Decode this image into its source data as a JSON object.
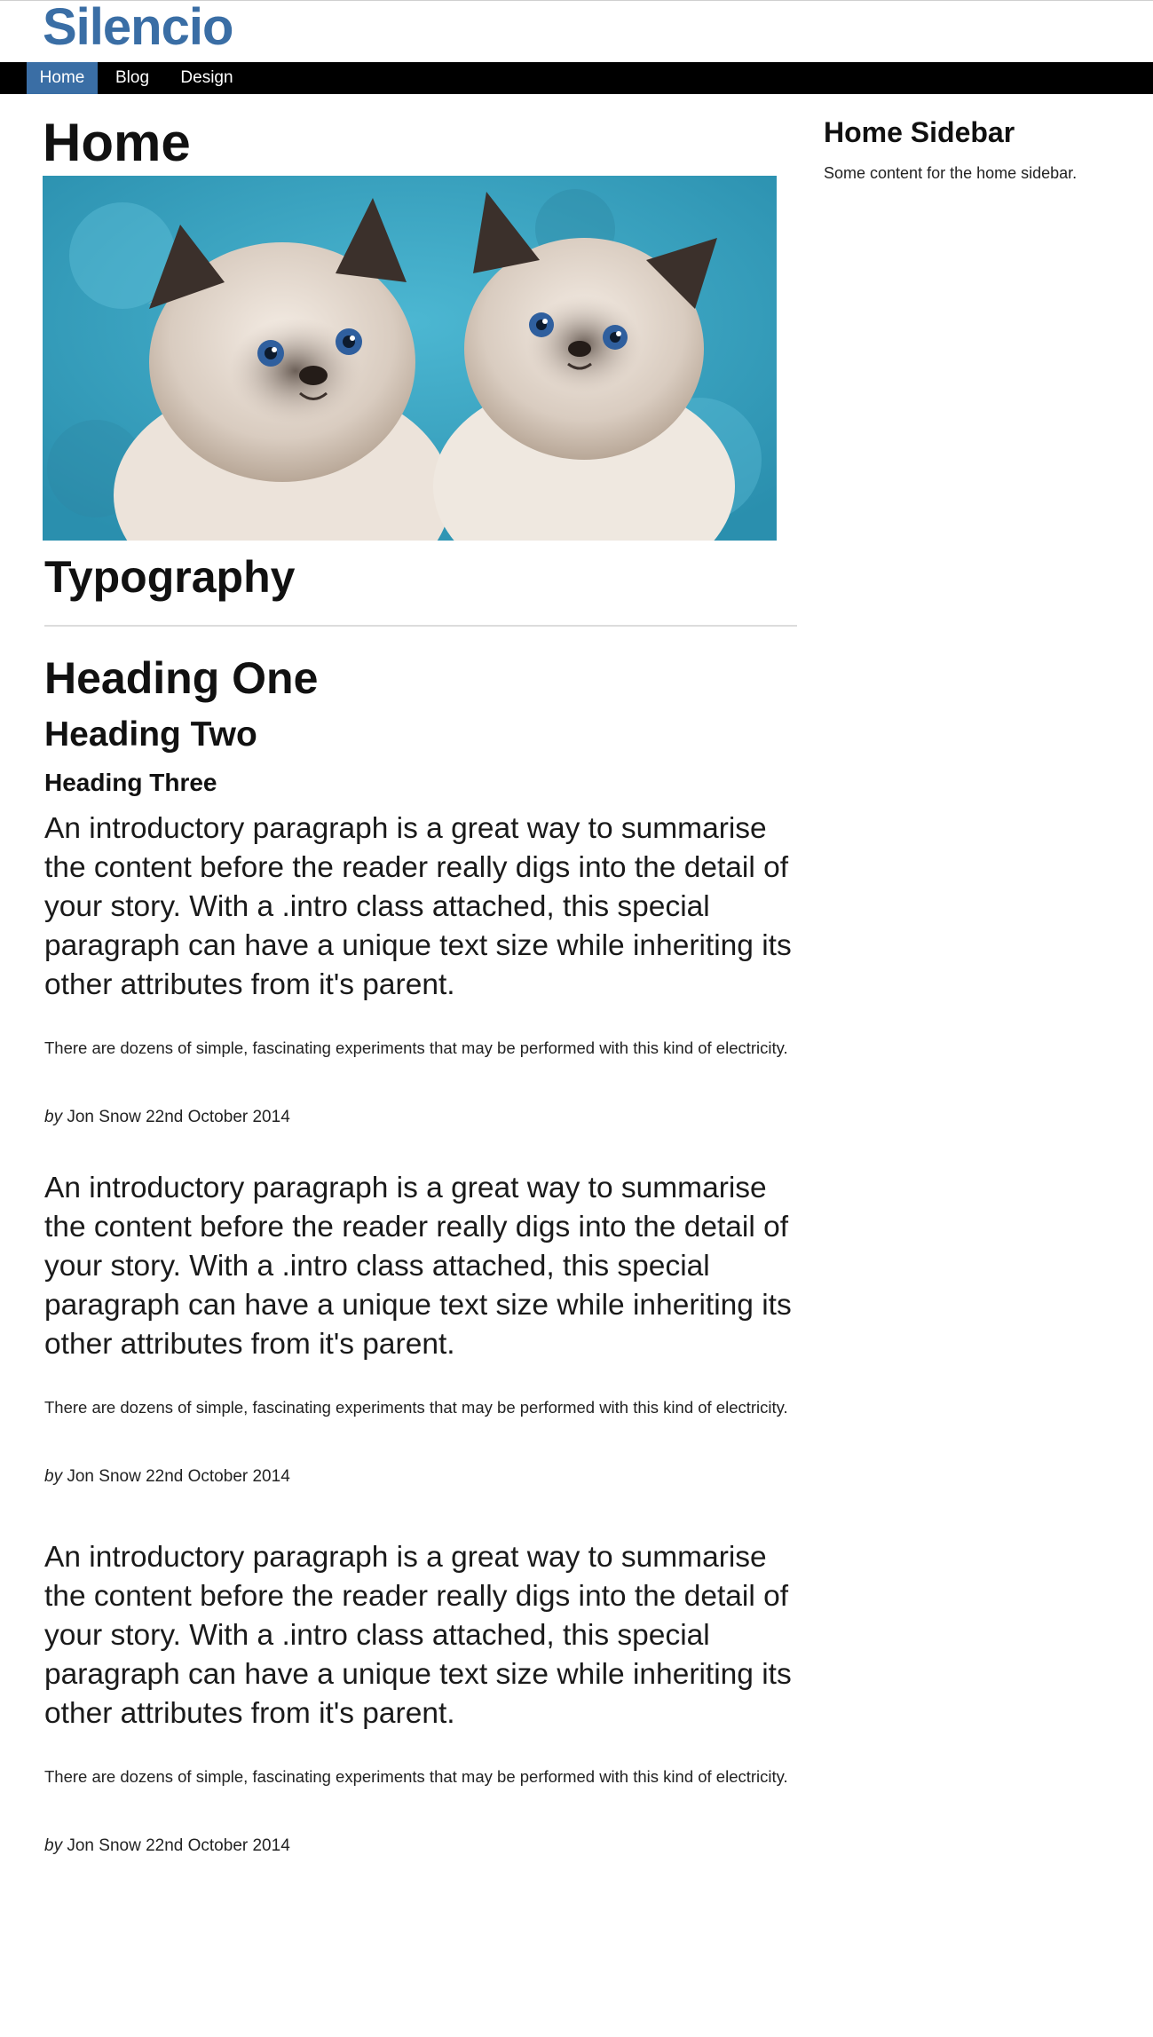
{
  "site": {
    "title": "Silencio"
  },
  "nav": {
    "items": [
      {
        "label": "Home",
        "active": true
      },
      {
        "label": "Blog",
        "active": false
      },
      {
        "label": "Design",
        "active": false
      }
    ]
  },
  "main": {
    "title": "Home",
    "hero_image_alt": "Two fluffy cream kittens with blue eyes on a blue background",
    "section_title": "Typography",
    "heading_one": "Heading One",
    "heading_two": "Heading Two",
    "heading_three": "Heading Three",
    "articles": [
      {
        "intro": "An introductory paragraph is a great way to summarise the content before the reader really digs into the detail of your story. With a .intro class attached, this special paragraph can have a unique text size while inheriting its other attributes from it's parent.",
        "body": "There are dozens of simple, fascinating experiments that may be performed with this kind of electricity.",
        "byline_prefix": "by",
        "byline_rest": "Jon Snow 22nd October 2014"
      },
      {
        "intro": "An introductory paragraph is a great way to summarise the content before the reader really digs into the detail of your story. With a .intro class attached, this special paragraph can have a unique text size while inheriting its other attributes from it's parent.",
        "body": "There are dozens of simple, fascinating experiments that may be performed with this kind of electricity.",
        "byline_prefix": "by",
        "byline_rest": "Jon Snow 22nd October 2014"
      },
      {
        "intro": "An introductory paragraph is a great way to summarise the content before the reader really digs into the detail of your story. With a .intro class attached, this special paragraph can have a unique text size while inheriting its other attributes from it's parent.",
        "body": "There are dozens of simple, fascinating experiments that may be performed with this kind of electricity.",
        "byline_prefix": "by",
        "byline_rest": "Jon Snow 22nd October 2014"
      }
    ]
  },
  "sidebar": {
    "title": "Home Sidebar",
    "text": "Some content for the home sidebar."
  },
  "colors": {
    "brand": "#3a6ea5",
    "nav_background": "#000000",
    "nav_active": "#3a6ea5"
  }
}
